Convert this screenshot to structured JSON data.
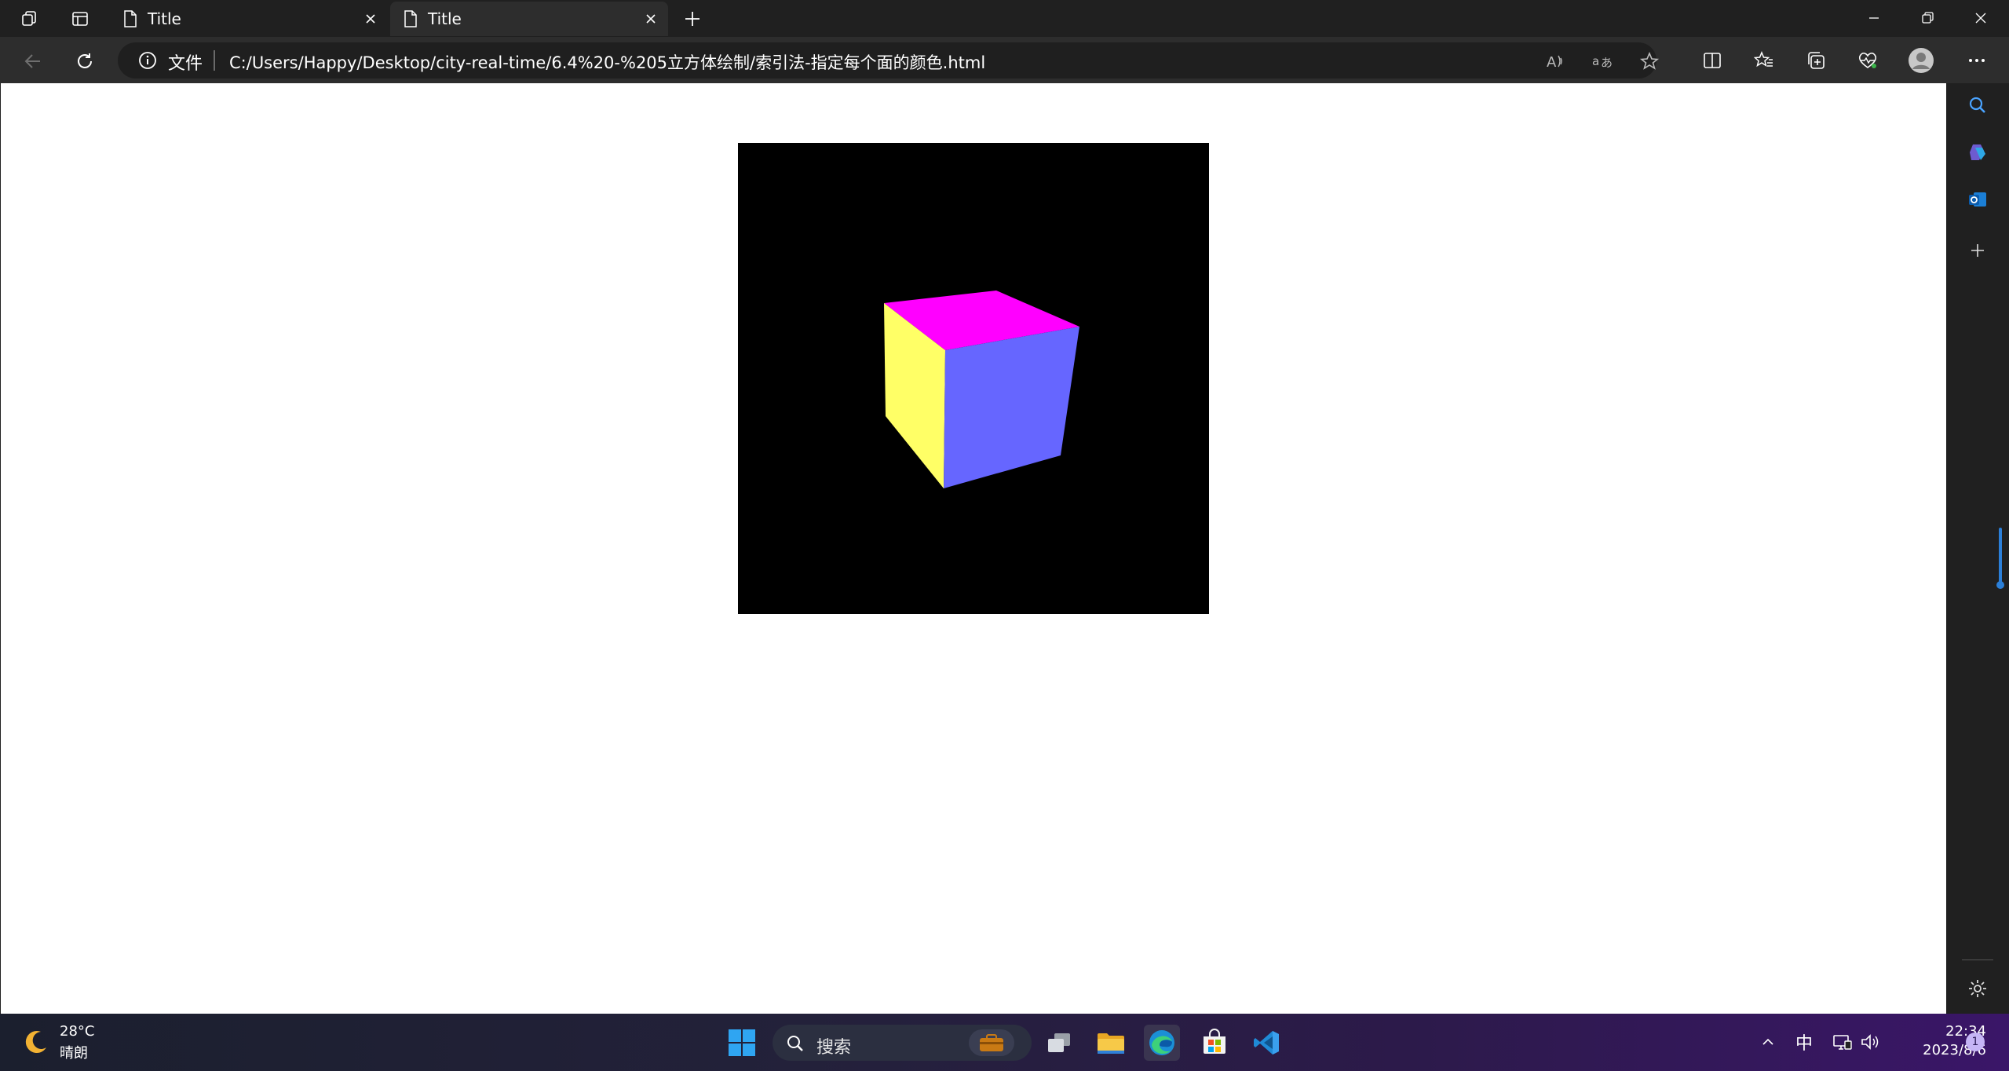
{
  "browser": {
    "tabs": [
      {
        "title": "Title",
        "active": false
      },
      {
        "title": "Title",
        "active": true
      }
    ],
    "address": {
      "scheme_label": "文件",
      "url": "C:/Users/Happy/Desktop/city-real-time/6.4%20-%205立方体绘制/索引法-指定每个面的颜色.html"
    },
    "accent": "#2b7fd8"
  },
  "canvas": {
    "background": "#000000",
    "cube_faces": {
      "top": "#ff00ff",
      "left": "#ffff66",
      "right": "#6666ff"
    }
  },
  "taskbar": {
    "weather": {
      "temp": "28°C",
      "desc": "晴朗"
    },
    "search_placeholder": "搜索",
    "ime": "中",
    "clock": {
      "time": "22:34",
      "date": "2023/8/6"
    },
    "notification_count": "1"
  }
}
